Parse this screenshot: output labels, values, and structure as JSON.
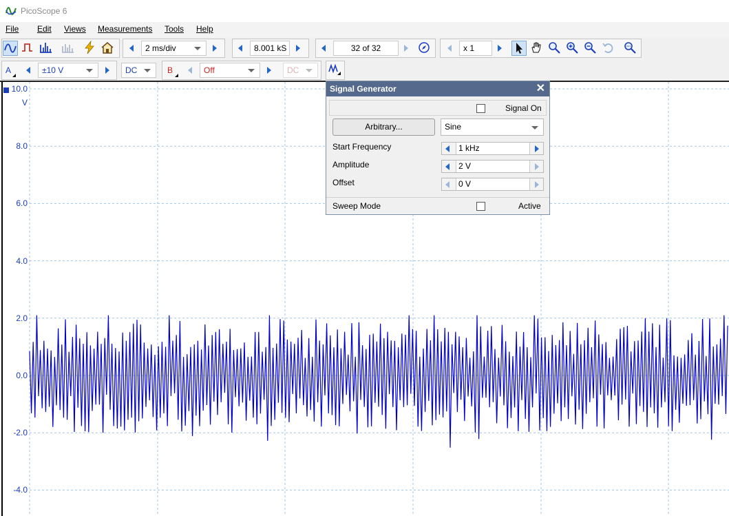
{
  "app": {
    "title": "PicoScope 6"
  },
  "menu": [
    "File",
    "Edit",
    "Views",
    "Measurements",
    "Tools",
    "Help"
  ],
  "toolbar1": {
    "timebase": "2 ms/div",
    "samples": "8.001 kS",
    "buffer": "32 of 32",
    "zoom": "x 1"
  },
  "toolbar2": {
    "channel_a_label": "A",
    "channel_a_range": "±10 V",
    "channel_a_coupling": "DC",
    "channel_b_label": "B",
    "channel_b_range": "Off",
    "channel_b_coupling": "DC"
  },
  "scope": {
    "y_unit": "V",
    "y_ticks": [
      "10.0",
      "8.0",
      "6.0",
      "4.0",
      "2.0",
      "0.0",
      "-2.0",
      "-4.0"
    ],
    "trace_color": "#0000cc",
    "grid_color": "#9fc5e2",
    "trace": {
      "amplitude_v": 2.0,
      "center_v": 0.0,
      "y_range": [
        -4.8,
        10.0
      ]
    }
  },
  "signal_generator": {
    "title": "Signal Generator",
    "signal_on_label": "Signal On",
    "signal_on_checked": false,
    "arbitrary_button": "Arbitrary...",
    "waveform": "Sine",
    "start_frequency_label": "Start Frequency",
    "start_frequency_value": "1 kHz",
    "amplitude_label": "Amplitude",
    "amplitude_value": "2 V",
    "offset_label": "Offset",
    "offset_value": "0 V",
    "sweep_mode_label": "Sweep Mode",
    "sweep_active_label": "Active",
    "sweep_active_checked": false
  }
}
